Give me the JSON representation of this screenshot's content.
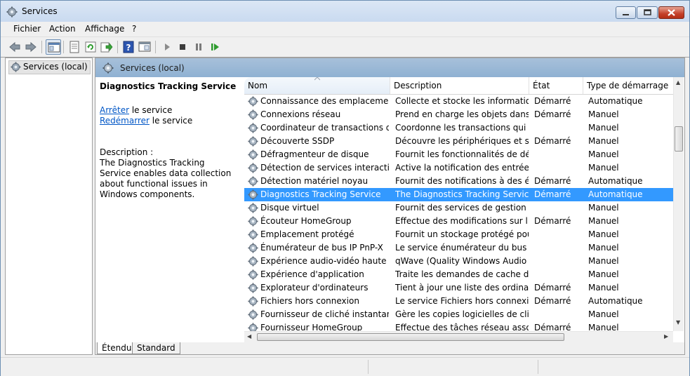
{
  "window": {
    "title": "Services"
  },
  "menu": [
    "Fichier",
    "Action",
    "Affichage",
    "?"
  ],
  "tree": {
    "root": "Services (local)"
  },
  "main": {
    "header": "Services (local)",
    "selected_service": "Diagnostics Tracking Service",
    "actions": [
      {
        "link": "Arrêter",
        "suffix": " le service"
      },
      {
        "link": "Redémarrer",
        "suffix": " le service"
      }
    ],
    "description_label": "Description :",
    "description_text": "The Diagnostics Tracking Service enables data collection about functional issues in Windows components."
  },
  "columns": [
    "Nom",
    "Description",
    "État",
    "Type de démarrage"
  ],
  "rows": [
    {
      "name": "Connaissance des emplacements...",
      "desc": "Collecte et stocke les information...",
      "state": "Démarré",
      "startup": "Automatique"
    },
    {
      "name": "Connexions réseau",
      "desc": "Prend en charge les objets dans l...",
      "state": "Démarré",
      "startup": "Manuel"
    },
    {
      "name": "Coordinateur de transactions dist...",
      "desc": "Coordonne les transactions qui c...",
      "state": "",
      "startup": "Manuel"
    },
    {
      "name": "Découverte SSDP",
      "desc": "Découvre les périphériques et ser...",
      "state": "Démarré",
      "startup": "Manuel"
    },
    {
      "name": "Défragmenteur de disque",
      "desc": "Fournit les fonctionnalités de défr...",
      "state": "",
      "startup": "Manuel"
    },
    {
      "name": "Détection de services interactifs",
      "desc": "Active la notification des entrées ...",
      "state": "",
      "startup": "Manuel"
    },
    {
      "name": "Détection matériel noyau",
      "desc": "Fournit des notifications à des év...",
      "state": "Démarré",
      "startup": "Automatique"
    },
    {
      "name": "Diagnostics Tracking Service",
      "desc": "The Diagnostics Tracking Service ...",
      "state": "Démarré",
      "startup": "Automatique",
      "selected": true
    },
    {
      "name": "Disque virtuel",
      "desc": "Fournit des services de gestion de...",
      "state": "",
      "startup": "Manuel"
    },
    {
      "name": "Écouteur HomeGroup",
      "desc": "Effectue des modifications sur l'o...",
      "state": "Démarré",
      "startup": "Manuel"
    },
    {
      "name": "Emplacement protégé",
      "desc": "Fournit un stockage protégé pour...",
      "state": "",
      "startup": "Manuel"
    },
    {
      "name": "Énumérateur de bus IP PnP-X",
      "desc": "Le service énumérateur du bus P...",
      "state": "",
      "startup": "Manuel"
    },
    {
      "name": "Expérience audio-vidéo haute qu...",
      "desc": "qWave (Quality Windows Audio ...",
      "state": "",
      "startup": "Manuel"
    },
    {
      "name": "Expérience d'application",
      "desc": "Traite les demandes de cache de ...",
      "state": "",
      "startup": "Manuel"
    },
    {
      "name": "Explorateur d'ordinateurs",
      "desc": "Tient à jour une liste des ordinate...",
      "state": "Démarré",
      "startup": "Manuel"
    },
    {
      "name": "Fichiers hors connexion",
      "desc": "Le service Fichiers hors connexio...",
      "state": "Démarré",
      "startup": "Automatique"
    },
    {
      "name": "Fournisseur de cliché instantané ...",
      "desc": "Gère les copies logicielles de clich...",
      "state": "",
      "startup": "Manuel"
    },
    {
      "name": "Fournisseur HomeGroup",
      "desc": "Effectue des tâches réseau associ...",
      "state": "Démarré",
      "startup": "Manuel"
    }
  ],
  "tabs": [
    "Étendu",
    "Standard"
  ],
  "colors": {
    "selection": "#3399ff",
    "header_gradient": "#8fb1d2",
    "link": "#0056c6"
  },
  "icons": [
    "services-gear-icon",
    "back-icon",
    "forward-icon",
    "console-tree-icon",
    "properties-icon",
    "refresh-icon",
    "export-icon",
    "help-icon",
    "view-icon",
    "start-icon",
    "stop-icon",
    "pause-icon",
    "resume-icon"
  ]
}
